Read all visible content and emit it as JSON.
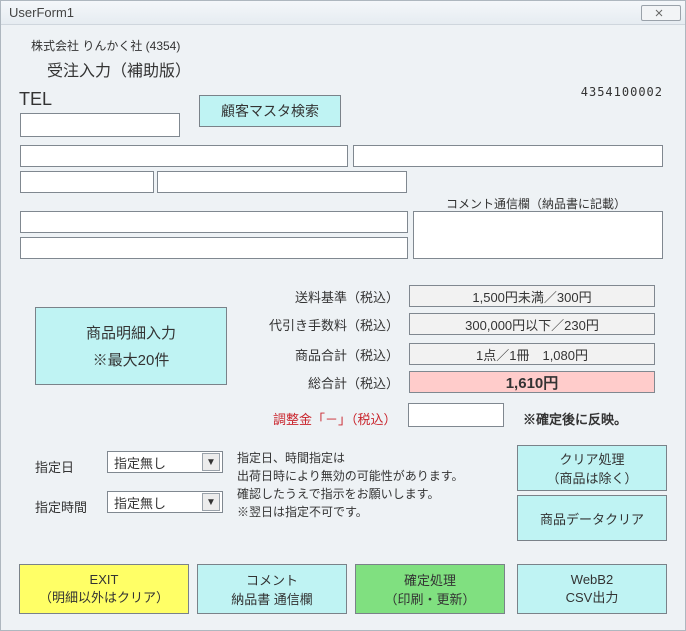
{
  "window": {
    "title": "UserForm1"
  },
  "header": {
    "company": "株式会社 りんかく社 (4354)",
    "page_title": "受注入力（補助版）",
    "serial": "4354100002"
  },
  "tel": {
    "label": "TEL",
    "value": ""
  },
  "search_button": "顧客マスタ検索",
  "comment_section_label": "コメント通信欄（納品書に記載）",
  "big_button": {
    "line1": "商品明細入力",
    "line2": "※最大20件"
  },
  "summary": {
    "rows": [
      {
        "label": "送料基準（税込）",
        "value": "1,500円未満／300円"
      },
      {
        "label": "代引き手数料（税込）",
        "value": "300,000円以下／230円"
      },
      {
        "label": "商品合計（税込）",
        "value": "1点／1冊　1,080円"
      },
      {
        "label": "総合計（税込）",
        "value": "1,610円"
      }
    ]
  },
  "adjust": {
    "label": "調整金「－」（税込）",
    "note": "※確定後に反映。",
    "value": ""
  },
  "dates": {
    "date_label": "指定日",
    "date_value": "指定無し",
    "time_label": "指定時間",
    "time_value": "指定無し"
  },
  "notes": {
    "l1": "指定日、時間指定は",
    "l2": "出荷日時により無効の可能性があります。",
    "l3": "確認したうえで指示をお願いします。",
    "l4": "※翌日は指定不可です。"
  },
  "right_buttons": {
    "clear1_l1": "クリア処理",
    "clear1_l2": "（商品は除く）",
    "clear2": "商品データクリア"
  },
  "bottom": {
    "exit_l1": "EXIT",
    "exit_l2": "（明細以外はクリア）",
    "comment_l1": "コメント",
    "comment_l2": "納品書 通信欄",
    "confirm_l1": "確定処理",
    "confirm_l2": "（印刷・更新）",
    "csv_l1": "WebB2",
    "csv_l2": "CSV出力"
  }
}
